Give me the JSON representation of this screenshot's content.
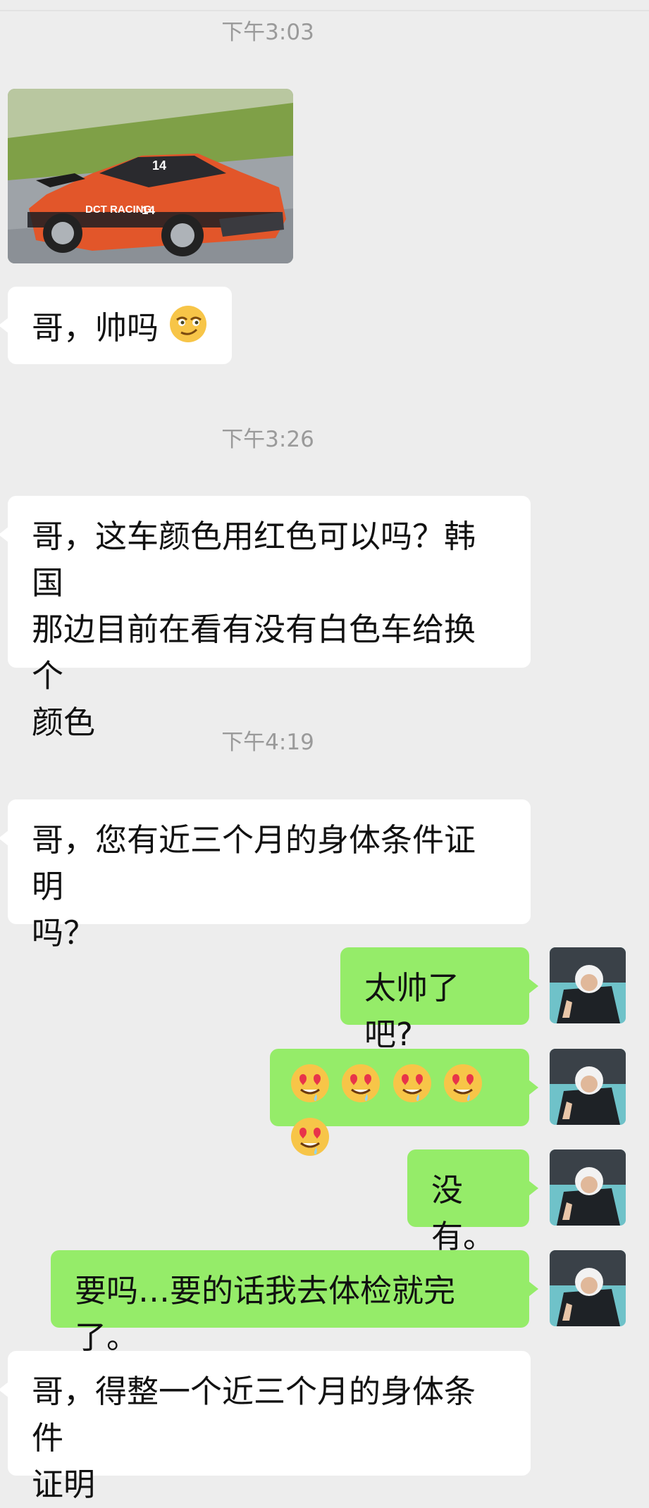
{
  "chat": {
    "timestamps": [
      "下午3:03",
      "下午3:26",
      "下午4:19"
    ],
    "photo": {
      "car_number": "14",
      "sponsor": "DCT RACING"
    },
    "messages": [
      {
        "side": "left",
        "text": "哥，帅吗",
        "emoji": "smirk-face"
      },
      {
        "side": "left",
        "lines": [
          "哥，这车颜色用红色可以吗？韩国",
          "那边目前在看有没有白色车给换个",
          "颜色"
        ]
      },
      {
        "side": "left",
        "lines": [
          "哥，您有近三个月的身体条件证明",
          "吗？"
        ]
      },
      {
        "side": "right",
        "text": "太帅了吧?"
      },
      {
        "side": "right",
        "emojis": [
          "heart-eyes-drool",
          "heart-eyes-drool",
          "heart-eyes-drool",
          "heart-eyes-drool",
          "heart-eyes-drool"
        ]
      },
      {
        "side": "right",
        "text": "没有。"
      },
      {
        "side": "right",
        "text": "要吗…要的话我去体检就完了。"
      },
      {
        "side": "left",
        "lines": [
          "哥，得整一个近三个月的身体条件",
          "证明"
        ]
      }
    ]
  },
  "colors": {
    "background": "#ededed",
    "incoming_bubble": "#ffffff",
    "outgoing_bubble": "#95ec69",
    "timestamp_text": "#9a9a9a"
  }
}
